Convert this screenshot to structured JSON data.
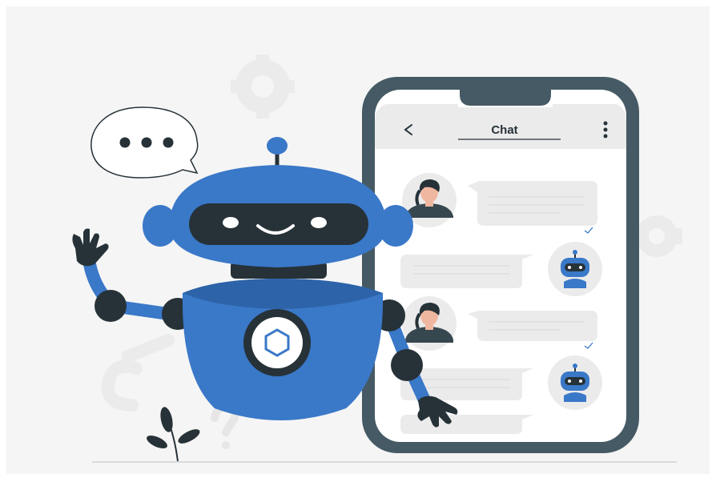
{
  "phone": {
    "header": {
      "back_icon": "chevron-left-icon",
      "title": "Chat",
      "menu_icon": "kebab-menu-icon"
    },
    "messages": [
      {
        "sender": "user",
        "avatar": "person-avatar"
      },
      {
        "sender": "bot",
        "avatar": "robot-avatar"
      },
      {
        "sender": "user",
        "avatar": "person-avatar"
      },
      {
        "sender": "bot",
        "avatar": "robot-avatar"
      }
    ]
  },
  "speech_bubble": {
    "icon": "ellipsis-icon"
  },
  "colors": {
    "robot_blue": "#3a78c8",
    "dark": "#263238",
    "phone_frame": "#455a64",
    "background": "#f5f5f5",
    "bubble_gray": "#ebebeb"
  }
}
